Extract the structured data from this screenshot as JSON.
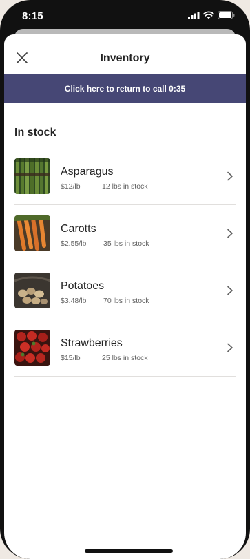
{
  "status_bar": {
    "time": "8:15"
  },
  "header": {
    "title": "Inventory",
    "close_icon": "close-icon"
  },
  "call_banner": {
    "text": "Click here to return to call 0:35",
    "color": "#464775"
  },
  "section": {
    "title": "In stock"
  },
  "items": [
    {
      "name": "Asparagus",
      "price": "$12/lb",
      "stock": "12 lbs in stock",
      "thumb": "asparagus"
    },
    {
      "name": "Carotts",
      "price": "$2.55/lb",
      "stock": "35 lbs in stock",
      "thumb": "carrots"
    },
    {
      "name": "Potatoes",
      "price": "$3.48/lb",
      "stock": "70 lbs in stock",
      "thumb": "potatoes"
    },
    {
      "name": "Strawberries",
      "price": "$15/lb",
      "stock": "25 lbs in stock",
      "thumb": "strawberries"
    }
  ]
}
